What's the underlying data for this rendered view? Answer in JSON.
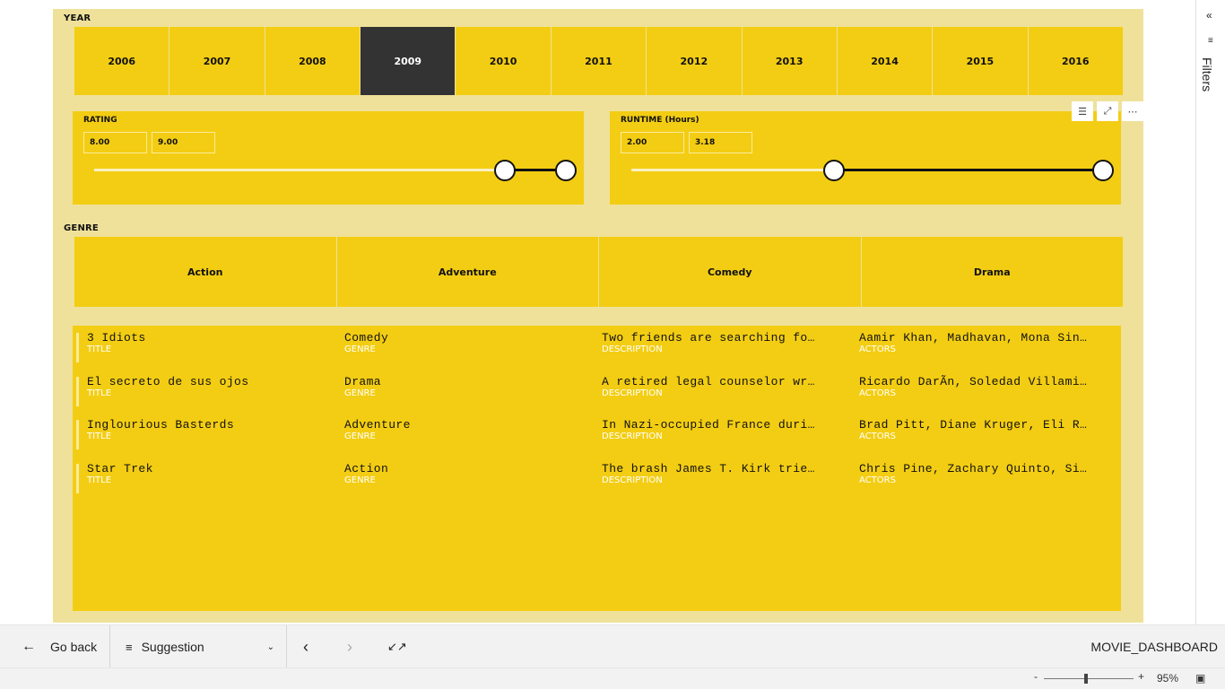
{
  "year_slicer": {
    "label": "YEAR",
    "selected": "2009",
    "years": [
      "2006",
      "2007",
      "2008",
      "2009",
      "2010",
      "2011",
      "2012",
      "2013",
      "2014",
      "2015",
      "2016"
    ]
  },
  "rating_slicer": {
    "label": "RATING",
    "min": "8.00",
    "max": "9.00",
    "min_fraction": 0.87,
    "max_fraction": 1.0
  },
  "runtime_slicer": {
    "label": "RUNTIME (Hours)",
    "min": "2.00",
    "max": "3.18",
    "min_fraction": 0.43,
    "max_fraction": 1.0
  },
  "genre_slicer": {
    "label": "GENRE",
    "genres": [
      "Action",
      "Adventure",
      "Comedy",
      "Drama"
    ]
  },
  "movie_list": {
    "labels": {
      "title": "TITLE",
      "genre": "GENRE",
      "description": "DESCRIPTION",
      "actors": "ACTORS"
    },
    "rows": [
      {
        "title": "3 Idiots",
        "genre": "Comedy",
        "description": "Two friends are searching fo…",
        "actors": "Aamir Khan, Madhavan, Mona Sin…"
      },
      {
        "title": "El secreto de sus ojos",
        "genre": "Drama",
        "description": "A retired legal counselor wr…",
        "actors": "Ricardo DarÃn, Soledad Villami…"
      },
      {
        "title": "Inglourious Basterds",
        "genre": "Adventure",
        "description": "In Nazi-occupied France duri…",
        "actors": "Brad Pitt, Diane Kruger, Eli R…"
      },
      {
        "title": "Star Trek",
        "genre": "Action",
        "description": "The brash James T. Kirk trie…",
        "actors": "Chris Pine, Zachary Quinto, Si…"
      }
    ]
  },
  "filters_pane": {
    "label": "Filters",
    "collapse_icon": "double-chevron-left-icon"
  },
  "bottom_bar": {
    "go_back": "Go back",
    "bookmark": "Suggestion",
    "report_name": "MOVIE_DASHBOARD"
  },
  "status_bar": {
    "zoom_minus": "-",
    "zoom_plus": "+",
    "zoom_level": "95%"
  },
  "colors": {
    "canvas": "#efe19a",
    "tile": "#f3cd13",
    "selected": "#333333"
  }
}
